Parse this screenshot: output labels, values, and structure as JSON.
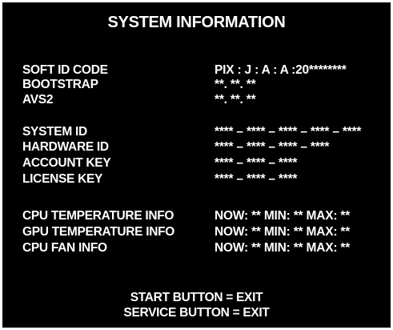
{
  "title": "SYSTEM INFORMATION",
  "rows": [
    {
      "label": "SOFT ID CODE",
      "value": "PIX : J : A : A :20********"
    },
    {
      "label": "BOOTSTRAP",
      "value": "**. **. **"
    },
    {
      "label": "AVS2",
      "value": "**. **. **"
    },
    {
      "label": "SYSTEM ID",
      "value": "**** – **** – **** – **** – ****"
    },
    {
      "label": "HARDWARE ID",
      "value": "**** – **** – **** – ****"
    },
    {
      "label": "ACCOUNT KEY",
      "value": "**** – **** – ****"
    },
    {
      "label": "LICENSE KEY",
      "value": "**** – **** – ****"
    },
    {
      "label": "CPU TEMPERATURE INFO",
      "value": "NOW: ** MIN: ** MAX: **"
    },
    {
      "label": "GPU TEMPERATURE INFO",
      "value": "NOW: ** MIN: ** MAX: **"
    },
    {
      "label": "CPU FAN INFO",
      "value": "NOW: ** MIN: ** MAX: **"
    }
  ],
  "footer": {
    "start": "START BUTTON = EXIT",
    "service": "SERVICE BUTTON = EXIT"
  }
}
